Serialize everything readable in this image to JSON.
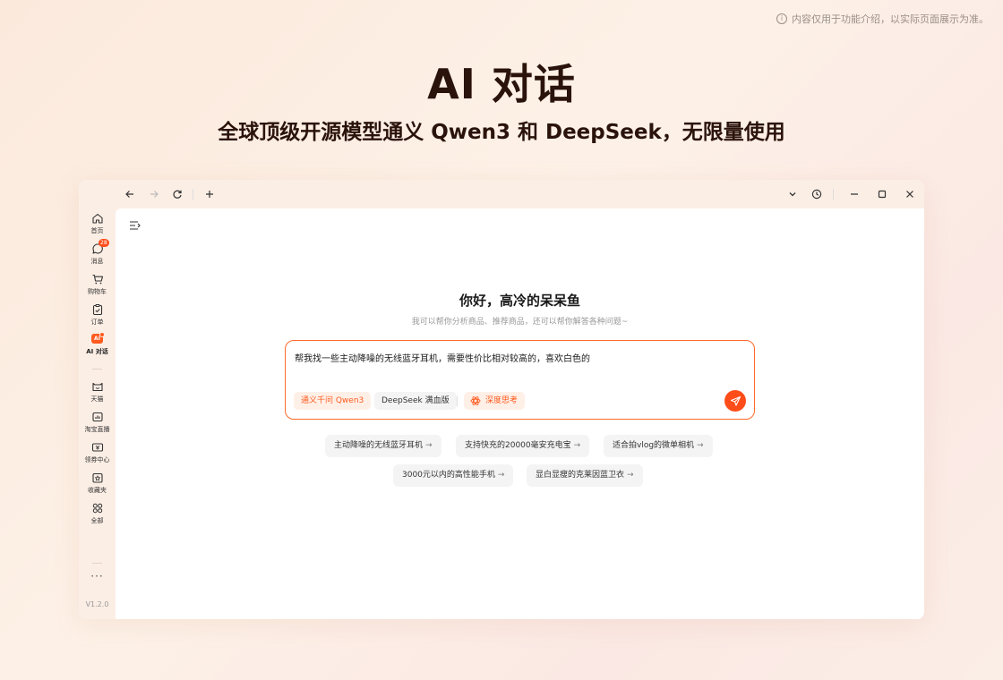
{
  "disclaimer": "内容仅用于功能介绍，以实际页面展示为准。",
  "hero": {
    "title": "AI 对话",
    "subtitle": "全球顶级开源模型通义 Qwen3 和 DeepSeek，无限量使用"
  },
  "titlebar": {
    "back_icon": "arrow-left-icon",
    "forward_icon": "arrow-right-icon",
    "refresh_icon": "refresh-icon",
    "new_tab_icon": "plus-icon",
    "dropdown_icon": "chevron-down-icon",
    "history_icon": "clock-icon",
    "minimize_icon": "minimize-icon",
    "maximize_icon": "maximize-icon",
    "close_icon": "close-icon"
  },
  "sidebar": {
    "items": [
      {
        "label": "首页",
        "icon": "home-icon"
      },
      {
        "label": "消息",
        "icon": "message-icon",
        "badge": "28"
      },
      {
        "label": "购物车",
        "icon": "cart-icon"
      },
      {
        "label": "订单",
        "icon": "order-icon"
      },
      {
        "label": "AI 对话",
        "icon": "ai-chat-icon",
        "chip": "AI",
        "active": true
      },
      {
        "label": "天猫",
        "icon": "tmall-icon"
      },
      {
        "label": "淘宝直播",
        "icon": "live-icon"
      },
      {
        "label": "领券中心",
        "icon": "coupon-icon"
      },
      {
        "label": "收藏夹",
        "icon": "favorites-icon"
      },
      {
        "label": "全部",
        "icon": "grid-icon"
      }
    ],
    "more": "···",
    "version": "V1.2.0"
  },
  "main": {
    "greeting": "你好，高冷的呆呆鱼",
    "greeting_sub": "我可以帮你分析商品、推荐商品，还可以帮你解答各种问题~",
    "input_text": "帮我找一些主动降噪的无线蓝牙耳机，需要性价比相对较高的，喜欢白色的",
    "models": {
      "qwen": "通义千问 Qwen3",
      "deepseek": "DeepSeek 满血版",
      "deep_think": "深度思考"
    },
    "suggestions": [
      "主动降噪的无线蓝牙耳机",
      "支持快充的20000毫安充电宝",
      "适合拍vlog的微单相机",
      "3000元以内的高性能手机",
      "显白显瘦的克莱因蓝卫衣"
    ],
    "suggestion_arrow": "→"
  },
  "colors": {
    "accent": "#ff5a1f",
    "title": "#2a130a"
  }
}
